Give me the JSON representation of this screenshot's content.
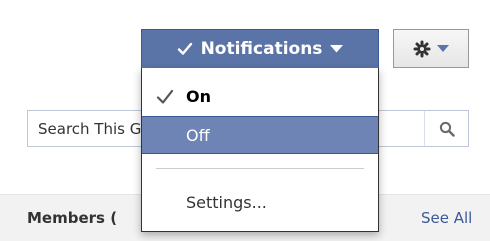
{
  "notifications": {
    "button_label": "Notifications",
    "menu": {
      "on_label": "On",
      "off_label": "Off",
      "settings_label": "Settings..."
    }
  },
  "search": {
    "placeholder": "Search This Group"
  },
  "members": {
    "heading": "Members (",
    "see_all_label": "See All"
  },
  "icons": {
    "notifications_check": "checkmark-icon",
    "notifications_caret": "caret-down-icon",
    "on_check": "checkmark-icon",
    "gear": "gear-icon",
    "gear_caret": "caret-down-icon",
    "search": "magnifier-icon"
  },
  "colors": {
    "notif_button_bg": "#5b74a8",
    "menu_highlight_bg": "#6d84b4",
    "link": "#3b5998",
    "members_bar_bg": "#f2f2f2"
  }
}
